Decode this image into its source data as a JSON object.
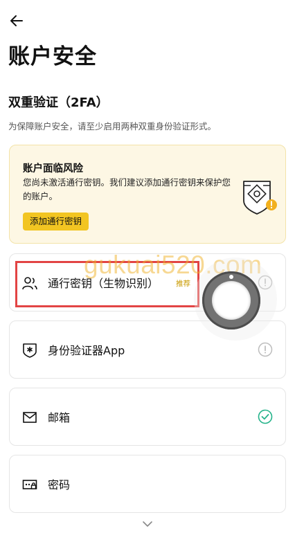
{
  "header": {
    "title": "账户安全"
  },
  "section": {
    "heading": "双重验证（2FA）",
    "description": "为保障账户安全，请至少启用两种双重身份验证形式。"
  },
  "risk_card": {
    "title": "账户面临风险",
    "text": "您尚未激活通行密钥。我们建议添加通行密钥来保护您的账户。",
    "button": "添加通行密钥"
  },
  "methods": [
    {
      "label": "通行密钥（生物识别）",
      "badge": "推荐",
      "status": "warning"
    },
    {
      "label": "身份验证器App",
      "status": "warning"
    },
    {
      "label": "邮箱",
      "status": "enabled"
    },
    {
      "label": "密码"
    }
  ],
  "watermark": "gukuai520.com",
  "colors": {
    "accent": "#f2c522",
    "success": "#24b38a",
    "warning_icon": "#bdbdbd",
    "highlight": "#e24444"
  }
}
